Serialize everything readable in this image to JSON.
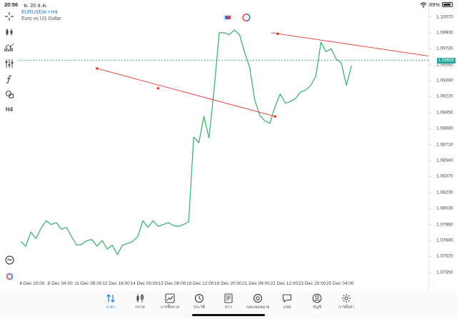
{
  "status_bar": {
    "time": "20:56",
    "date": "พ. 20 ธ.ค.",
    "battery": "89%",
    "battery_level": 0.89
  },
  "chart_header": {
    "symbol": "EURUSDm • H4",
    "description": "Euro vs US Dollar"
  },
  "price_scale": {
    "labels": [
      "1.10070",
      "1.09900",
      "1.09730",
      "1.09560",
      "1.09390",
      "1.09220",
      "1.09050",
      "1.08880",
      "1.08710",
      "1.08540",
      "1.08370",
      "1.08200",
      "1.08030",
      "1.07860",
      "1.07690",
      "1.07520",
      "1.07350"
    ],
    "current_price": "1.09606"
  },
  "time_axis": {
    "labels": [
      "6 Dec 20:00",
      "8 Dec 04:00",
      "11 Dec 08:00",
      "12 Dec 16:00",
      "14 Dec 00:00",
      "15 Dec 08:00",
      "18 Dec 12:00",
      "19 Dec 20:00",
      "21 Dec 04:00",
      "22 Dec 12:00",
      "23 Dec 20:00",
      "25 Dec 04:00"
    ]
  },
  "chart_data": {
    "type": "line",
    "series": [
      {
        "values": [
          1.0768,
          1.0763,
          1.0778,
          1.0771,
          1.0782,
          1.079,
          1.0786,
          1.0788,
          1.0781,
          1.0783,
          1.0773,
          1.0764,
          1.0765,
          1.0769,
          1.077,
          1.0763,
          1.0769,
          1.076,
          1.0764,
          1.0754,
          1.0764,
          1.0766,
          1.0768,
          1.0773,
          1.079,
          1.0783,
          1.079,
          1.0784,
          1.0786,
          1.0788,
          1.0785,
          1.0784,
          1.0786,
          1.0789,
          1.0879,
          1.0873,
          1.0901,
          1.0878,
          1.0929,
          1.099,
          1.099,
          1.0988,
          1.0993,
          1.0988,
          1.0969,
          1.0953,
          1.0918,
          1.0902,
          1.0896,
          1.0894,
          1.0912,
          1.0925,
          1.0915,
          1.0917,
          1.092,
          1.0927,
          1.0929,
          1.0934,
          1.0944,
          1.098,
          1.097,
          1.0973,
          1.0962,
          1.0958,
          1.0934,
          1.0955
        ]
      }
    ],
    "xlim": [
      "6 Dec 20:00",
      "25 Dec 04:00"
    ],
    "ylim": [
      1.0728,
      1.1015
    ],
    "trendlines": [
      {
        "color": "#e53935",
        "points": [
          [
            28,
            1.1007
          ],
          [
            50.5,
            1.0989
          ]
        ]
      },
      {
        "color": "#e53935",
        "points": [
          [
            15,
            1.0952
          ],
          [
            27,
            1.0931
          ],
          [
            50,
            1.0901
          ]
        ]
      }
    ],
    "current_price_line": 1.09606,
    "grid": false,
    "line_color": "#3cb371"
  },
  "bottom_nav": {
    "items": [
      {
        "label": "ราคา",
        "icon": "quotes-icon",
        "active": true
      },
      {
        "label": "กราฟ",
        "icon": "chart-icon",
        "active": false
      },
      {
        "label": "การซื้อขาย",
        "icon": "trade-icon",
        "active": false
      },
      {
        "label": "ประวัติ",
        "icon": "history-icon",
        "active": false
      },
      {
        "label": "ข่าว",
        "icon": "news-icon",
        "active": false
      },
      {
        "label": "กล่องจดหมาย",
        "icon": "mailbox-icon",
        "active": false
      },
      {
        "label": "แชท",
        "icon": "chat-icon",
        "active": false
      },
      {
        "label": "บัญชี",
        "icon": "account-icon",
        "active": false
      },
      {
        "label": "การตั้งค่า",
        "icon": "settings-icon",
        "active": false
      }
    ]
  },
  "left_toolbar": {
    "items": [
      "crosshair-icon",
      "candles-icon",
      "indicator-icon",
      "levels-icon",
      "function-icon",
      "shapes-icon",
      "timeframe-icon"
    ],
    "timeframe": "H4"
  }
}
